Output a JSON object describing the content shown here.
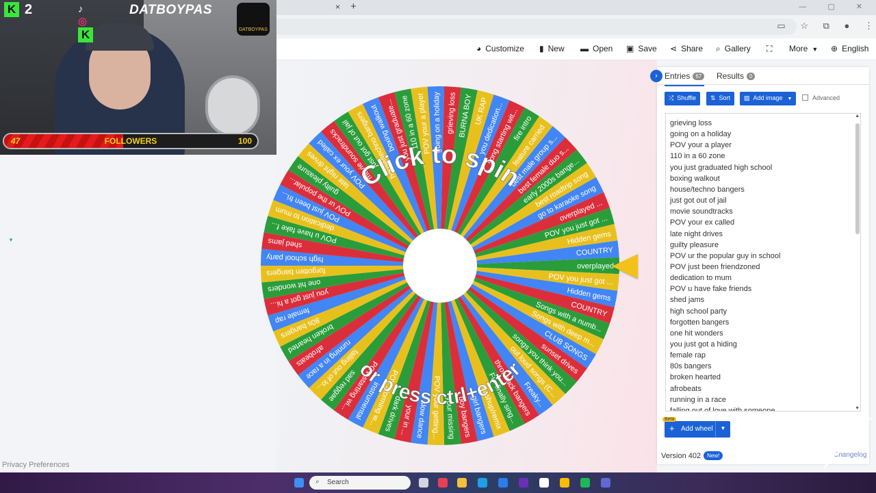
{
  "browser": {
    "tab_close": "×",
    "tab_new": "+",
    "window_controls": "— ▢ ✕"
  },
  "menu": {
    "items": [
      {
        "label": "Customize",
        "icon": "palette-icon"
      },
      {
        "label": "New",
        "icon": "file-icon"
      },
      {
        "label": "Open",
        "icon": "folder-icon"
      },
      {
        "label": "Save",
        "icon": "save-icon"
      },
      {
        "label": "Share",
        "icon": "share-icon"
      },
      {
        "label": "Gallery",
        "icon": "search-icon"
      },
      {
        "label": "",
        "icon": "fullscreen-icon"
      },
      {
        "label": "More",
        "icon": "chevron-down-icon"
      },
      {
        "label": "English",
        "icon": "globe-icon"
      }
    ]
  },
  "wheel": {
    "center_text_top": "Click to spin",
    "center_text_bottom": "or press ctrl+enter",
    "pointer_color": "#f2c21b",
    "colors": [
      "#2a9d3a",
      "#e8c01e",
      "#4285f4",
      "#db2e3b"
    ],
    "slices": [
      "overplayed",
      "POV you just got ...",
      "Hidden gems",
      "COUNTRY",
      "Songs with a numb...",
      "Songs with deep m...",
      "CLUB SONGS",
      "sunset drives",
      "songs you think you...",
      "out loud songs (C...",
      "Freaky...",
      "throwback bangers",
      "Fur finally sing...",
      "mashup/remix",
      "girl bangers",
      "boy bangers",
      "your missing",
      "POV your getting...",
      "slow dance",
      "your in ...",
      "dark drives",
      "POV storming w...",
      "instrumental",
      "POV starting wi...",
      "sad reggae",
      "falling out of lo...",
      "running in a race",
      "afrobeats",
      "broken hearted",
      "80s bangers",
      "female rap",
      "you just got a hi...",
      "one hit wonders",
      "forgotten bangers",
      "high school party",
      "shed jams",
      "POV u have fake f...",
      "dedication to mum",
      "POV just been fri...",
      "POV ur the popular...",
      "guilty pleasure",
      "late night drives",
      "POV your ex called",
      "movie soundtracks",
      "just got out of jail",
      "house/techno bangers",
      "boxing walkout",
      "you just graduate...",
      "110 in a 60 zone",
      "POV your a player",
      "going on a holiday",
      "grieving loss",
      "BURNA BOY",
      "UK RAP",
      "you dedication...",
      "song starting wit...",
      "fire intro",
      "feature carried",
      "best male group s...",
      "best female duo s...",
      "early 2000s bange...",
      "best roadtrip song",
      "go to karaoke song",
      "overplayed ...",
      "POV you just got ...",
      "Hidden gems",
      "COUNTRY"
    ]
  },
  "panel": {
    "tab_entries": "Entries",
    "entries_count": "67",
    "tab_results": "Results",
    "results_count": "0",
    "btn_shuffle": "Shuffle",
    "btn_sort": "Sort",
    "btn_add_image": "Add image",
    "advanced": "Advanced",
    "entries": [
      "grieving loss",
      "going on a holiday",
      "POV your a player",
      "110 in a 60 zone",
      "you just graduated high school",
      "boxing walkout",
      "house/techno bangers",
      "just got out of jail",
      "movie soundtracks",
      "POV your ex called",
      "late night drives",
      "guilty pleasure",
      "POV ur the popular guy in school",
      "POV just been friendzoned",
      "dedication to mum",
      "POV u have fake friends",
      "shed jams",
      "high school party",
      "forgotten bangers",
      "one hit wonders",
      "you just got a hiding",
      "female rap",
      "80s bangers",
      "broken hearted",
      "afrobeats",
      "running in a race",
      "falling out of love with someone"
    ],
    "beta": "Beta",
    "add_wheel": "Add wheel",
    "version": "Version 402",
    "new_badge": "New!",
    "changelog": "Changelog"
  },
  "privacy": "Privacy Preferences",
  "stream": {
    "kick_count": "2",
    "handle": "DATBOYPAS",
    "logo_text": "DATBOYPAS",
    "followers_current": "47",
    "followers_label": "FOLLOWERS",
    "followers_goal": "100",
    "followers_progress": 0.47
  },
  "taskbar": {
    "search_placeholder": "Search"
  }
}
